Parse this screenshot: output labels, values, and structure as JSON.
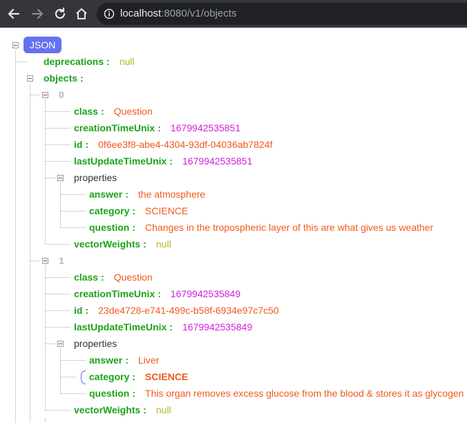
{
  "browser": {
    "url_host": "localhost",
    "url_rest": ":8080/v1/objects"
  },
  "tree": {
    "root_label": "JSON",
    "deprecations": {
      "key": "deprecations",
      "value": "null"
    },
    "objects_key": "objects",
    "items": [
      {
        "index": "0",
        "class_key": "class",
        "class": "Question",
        "ctime_key": "creationTimeUnix",
        "ctime": "1679942535851",
        "id_key": "id",
        "id": "0f6ee3f8-abe4-4304-93df-04036ab7824f",
        "utime_key": "lastUpdateTimeUnix",
        "utime": "1679942535851",
        "props_key": "properties",
        "answer_key": "answer",
        "answer": "the atmosphere",
        "category_key": "category",
        "category": "SCIENCE",
        "question_key": "question",
        "question": "Changes in the tropospheric layer of this are what gives us weather",
        "vw_key": "vectorWeights",
        "vw": "null"
      },
      {
        "index": "1",
        "class_key": "class",
        "class": "Question",
        "ctime_key": "creationTimeUnix",
        "ctime": "1679942535849",
        "id_key": "id",
        "id": "23de4728-e741-499c-b58f-6934e97c7c50",
        "utime_key": "lastUpdateTimeUnix",
        "utime": "1679942535849",
        "props_key": "properties",
        "answer_key": "answer",
        "answer": "Liver",
        "category_key": "category",
        "category": "SCIENCE",
        "question_key": "question",
        "question": "This organ removes excess glucose from the blood & stores it as glycogen",
        "vw_key": "vectorWeights",
        "vw": "null"
      }
    ]
  }
}
